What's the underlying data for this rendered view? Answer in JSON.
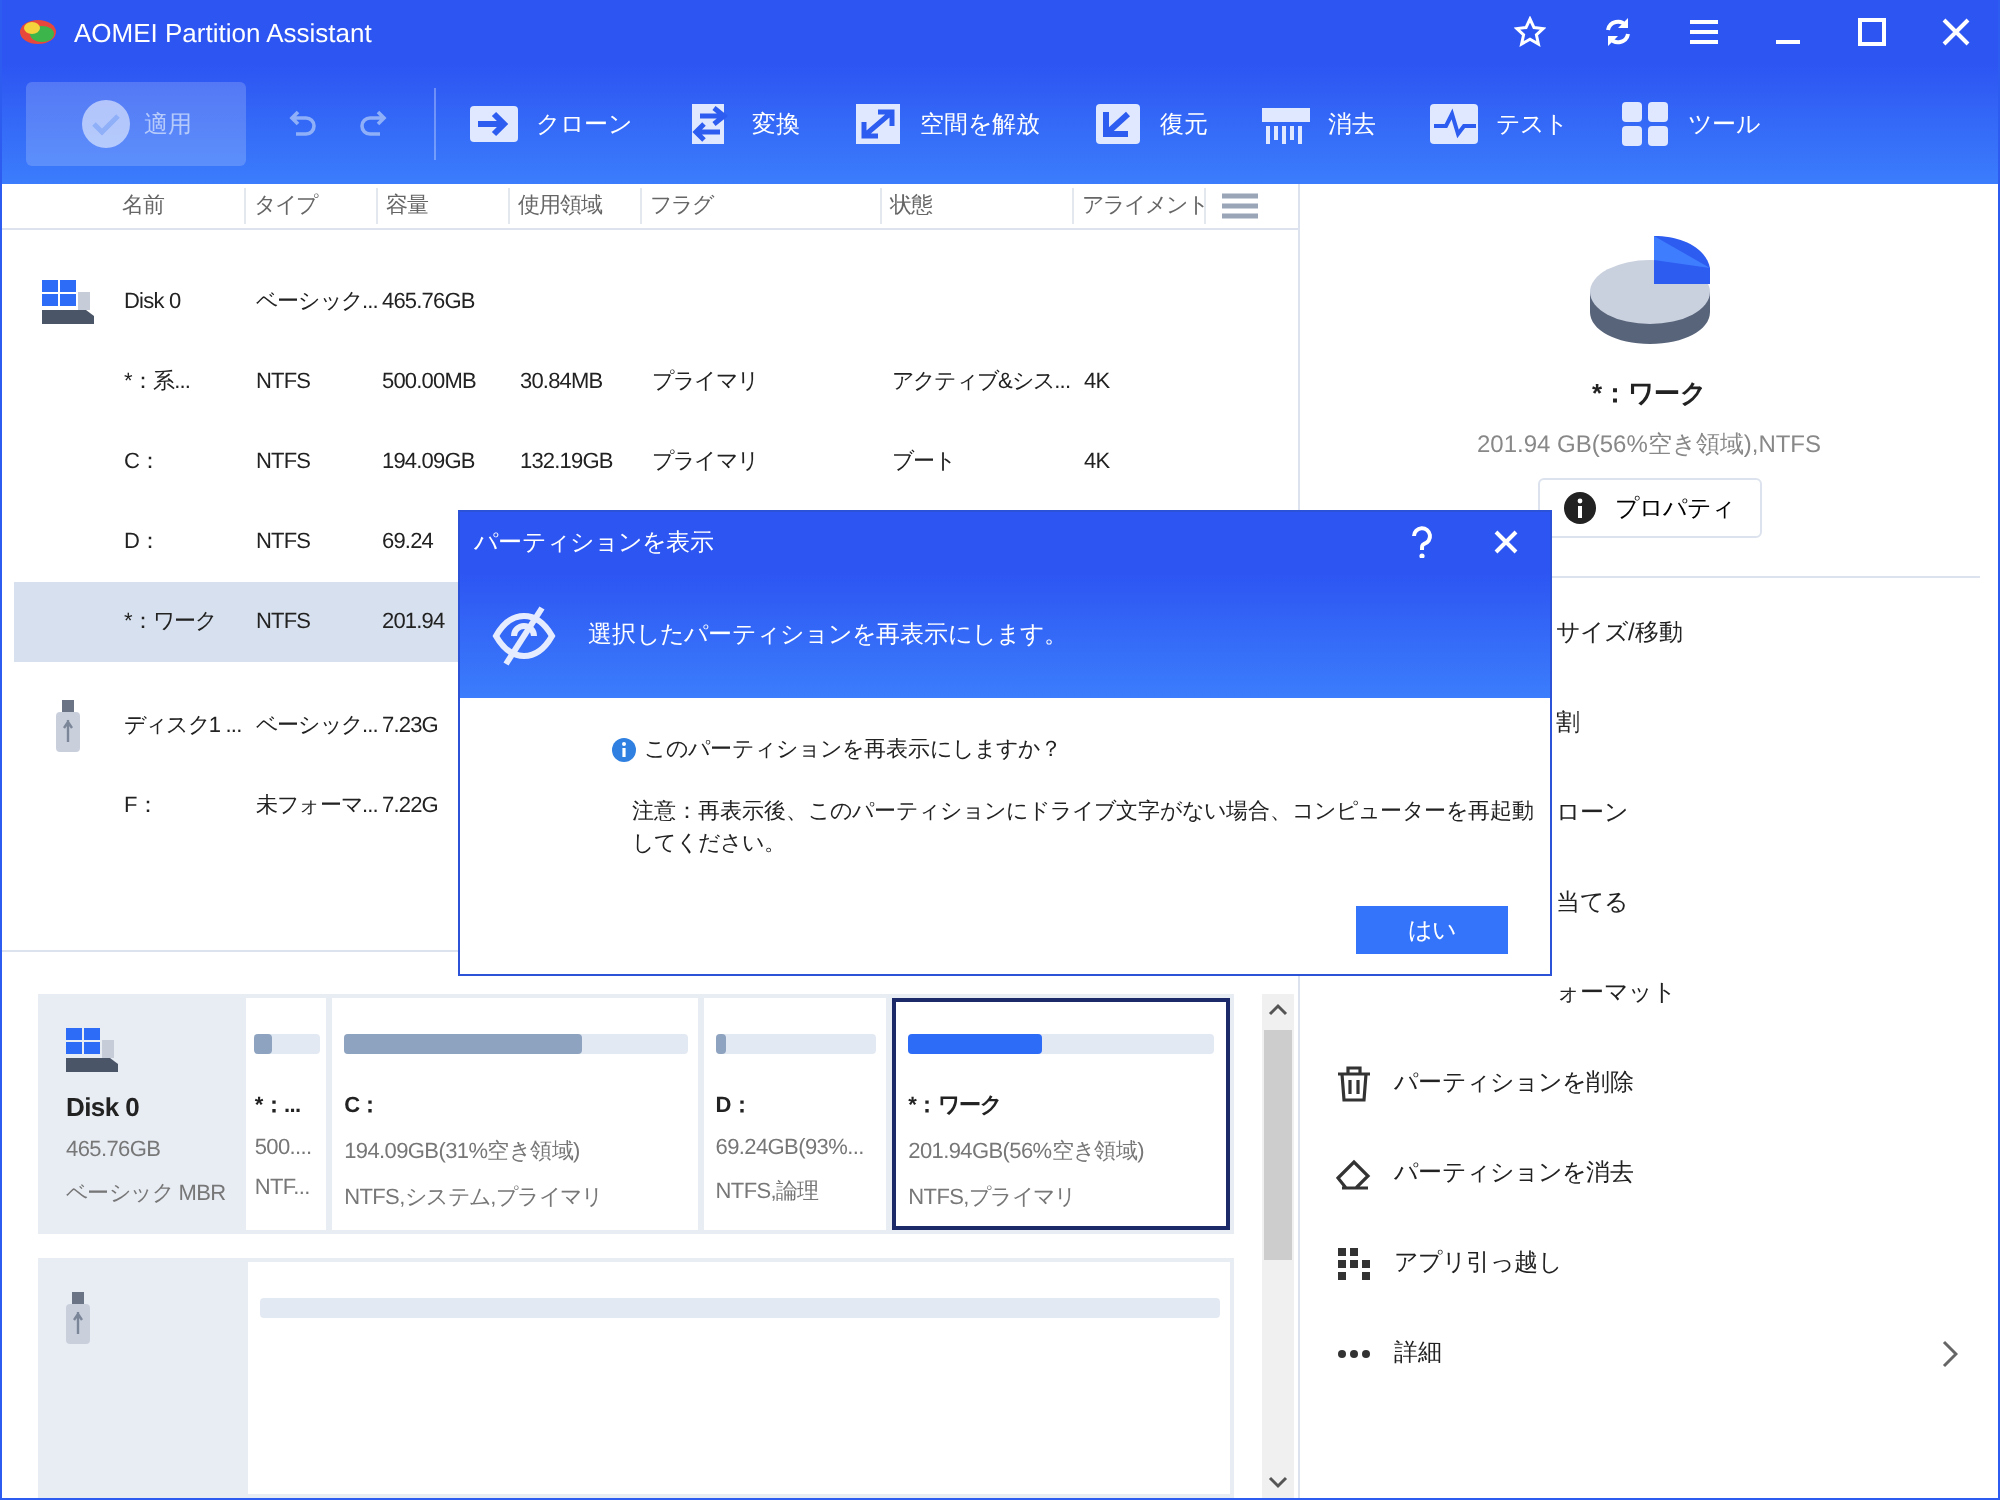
{
  "window": {
    "title": "AOMEI Partition Assistant"
  },
  "toolbar": {
    "apply": {
      "label": "適用",
      "disabled": true
    },
    "tools": [
      {
        "kind": "clone",
        "label": "クローン"
      },
      {
        "kind": "convert",
        "label": "変換"
      },
      {
        "kind": "free-space",
        "label": "空間を解放"
      },
      {
        "kind": "restore",
        "label": "復元"
      },
      {
        "kind": "wipe",
        "label": "消去"
      },
      {
        "kind": "test",
        "label": "テスト"
      },
      {
        "kind": "tools",
        "label": "ツール"
      }
    ]
  },
  "table": {
    "columns": [
      "名前",
      "タイプ",
      "容量",
      "使用領域",
      "フラグ",
      "状態",
      "アライメント"
    ],
    "rows": [
      {
        "kind": "disk",
        "selected": false,
        "cells": [
          "Disk 0",
          "ベーシック...",
          "465.76GB"
        ]
      },
      {
        "kind": "partition",
        "selected": false,
        "cells": [
          "*：系...",
          "NTFS",
          "500.00MB",
          "30.84MB",
          "プライマリ",
          "アクティブ&シス...",
          "4K"
        ]
      },
      {
        "kind": "partition",
        "selected": false,
        "cells": [
          "C：",
          "NTFS",
          "194.09GB",
          "132.19GB",
          "プライマリ",
          "ブート",
          "4K"
        ]
      },
      {
        "kind": "partition",
        "selected": false,
        "cells": [
          "D：",
          "NTFS",
          "69.24"
        ]
      },
      {
        "kind": "partition",
        "selected": true,
        "cells": [
          "*：ワーク",
          "NTFS",
          "201.94"
        ]
      },
      {
        "kind": "usb-disk",
        "selected": false,
        "cells": [
          "ディスク1 ...",
          "ベーシック...",
          "7.23G"
        ]
      },
      {
        "kind": "partition",
        "selected": false,
        "cells": [
          "F：",
          "未フォーマ...",
          "7.22G"
        ]
      }
    ]
  },
  "details": {
    "name": "*：ワーク",
    "info": "201.94 GB(56%空き領域),NTFS",
    "button": "プロパティ"
  },
  "actions": [
    {
      "kind": "covered",
      "label": "サイズ/移動"
    },
    {
      "kind": "covered",
      "label": "割"
    },
    {
      "kind": "covered",
      "label": "ローン"
    },
    {
      "kind": "covered",
      "label": "当てる"
    },
    {
      "kind": "covered",
      "label": "ォーマット"
    },
    {
      "kind": "trash",
      "label": "パーティションを削除"
    },
    {
      "kind": "eraser",
      "label": "パーティションを消去"
    },
    {
      "kind": "dots-grid",
      "label": "アプリ引っ越し"
    },
    {
      "kind": "more",
      "label": "詳細"
    }
  ],
  "disk_map": {
    "disks": [
      {
        "kind": "hdd",
        "name": "Disk 0",
        "size": "465.76GB",
        "type": "ベーシック MBR",
        "partitions": [
          {
            "name": "*：...",
            "size": "500....",
            "fs": "NTF...",
            "level": 0.25,
            "selected": false
          },
          {
            "name": "C：",
            "size": "194.09GB(31%空き領域)",
            "fs": "NTFS,システム,プライマリ",
            "level": 0.69,
            "selected": false
          },
          {
            "name": "D：",
            "size": "69.24GB(93%...",
            "fs": "NTFS,論理",
            "level": 0.07,
            "selected": false
          },
          {
            "name": "*：ワーク",
            "size": "201.94GB(56%空き領域)",
            "fs": "NTFS,プライマリ",
            "level": 0.44,
            "selected": true
          }
        ]
      },
      {
        "kind": "usb",
        "partitions": [
          {
            "selected": false
          }
        ]
      }
    ]
  },
  "dialog": {
    "title": "パーティションを表示",
    "header": "選択したパーティションを再表示にします。",
    "question": "このパーティションを再表示にしますか？",
    "note": "注意：再表示後、このパーティションにドライブ文字がない場合、コンピューターを再起動してください。",
    "ok": "はい"
  }
}
